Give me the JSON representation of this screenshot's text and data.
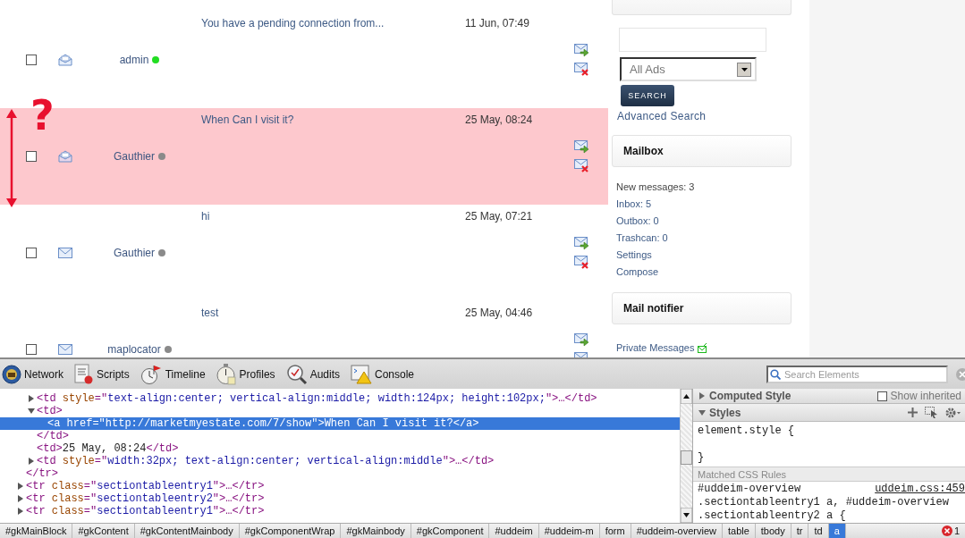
{
  "inbox": {
    "rows": [
      {
        "checked": false,
        "read": true,
        "from": "admin",
        "color": "#22dd22",
        "message": "You have a pending connection from...",
        "date": "11 Jun, 07:49",
        "highlighted": false
      },
      {
        "checked": false,
        "read": true,
        "from": "Gauthier",
        "color": "#8a8a8a",
        "message": "When Can I visit it?",
        "date": "25 May, 08:24",
        "highlighted": true
      },
      {
        "checked": false,
        "read": false,
        "from": "Gauthier",
        "color": "#8a8a8a",
        "message": "hi",
        "date": "25 May, 07:21",
        "highlighted": false
      },
      {
        "checked": false,
        "read": false,
        "from": "maplocator",
        "color": "#8a8a8a",
        "message": "test",
        "date": "25 May, 04:46",
        "highlighted": false
      }
    ]
  },
  "annotation": {
    "mark": "?"
  },
  "sidebar": {
    "select_value": "All Ads",
    "button": "SEARCH",
    "advanced_link": "Advanced Search",
    "panels": [
      {
        "title": "Mailbox",
        "items": [
          {
            "kind": "text",
            "text": "New messages: 3"
          },
          {
            "kind": "link",
            "text": "Inbox: 5"
          },
          {
            "kind": "link",
            "text": "Outbox: 0"
          },
          {
            "kind": "link",
            "text": "Trashcan: 0"
          },
          {
            "kind": "link",
            "text": "Settings"
          },
          {
            "kind": "link",
            "text": "Compose"
          }
        ]
      },
      {
        "title": "Mail notifier",
        "items": [
          {
            "kind": "notify",
            "text": "Private Messages"
          }
        ]
      }
    ]
  },
  "devtools": {
    "tabs": [
      {
        "kind": "network",
        "label": "Network",
        "selected": false
      },
      {
        "kind": "scripts",
        "label": "Scripts",
        "selected": false
      },
      {
        "kind": "timeline",
        "label": "Timeline",
        "selected": false
      },
      {
        "kind": "profiles",
        "label": "Profiles",
        "selected": false
      },
      {
        "kind": "audits",
        "label": "Audits",
        "selected": false
      },
      {
        "kind": "console",
        "label": "Console",
        "selected": false
      }
    ],
    "search": {
      "placeholder": "Search Elements"
    },
    "dom": [
      {
        "children": [
          {
            "selected": false,
            "expanded": false,
            "tokens": [
              {
                "kind": "tag",
                "text": "<td"
              },
              {
                "kind": "attr",
                "text": " style"
              },
              {
                "kind": "tag",
                "text": "=\""
              },
              {
                "kind": "value",
                "text": "text-align:center; vertical-align:middle; width:124px; height:102px;"
              },
              {
                "kind": "tag",
                "text": "\">…</td>"
              }
            ]
          },
          {
            "selected": false,
            "expanded": true,
            "tokens": [
              {
                "kind": "tag",
                "text": "<td>"
              }
            ],
            "children": [
              {
                "selected": true,
                "tokens": [
                  {
                    "text": "<a href=\"http://marketmyestate.com/7/show\">When Can I visit it?</a>"
                  }
                ]
              }
            ],
            "closing": [
              {
                "kind": "tag",
                "text": "</td>"
              }
            ]
          },
          {
            "selected": false,
            "tokens": [
              {
                "kind": "tag",
                "text": "<td>"
              },
              {
                "kind": "text",
                "text": "25 May, 08:24"
              },
              {
                "kind": "tag",
                "text": "</td>"
              }
            ]
          },
          {
            "selected": false,
            "expanded": false,
            "tokens": [
              {
                "kind": "tag",
                "text": "<td"
              },
              {
                "kind": "attr",
                "text": " style"
              },
              {
                "kind": "tag",
                "text": "=\""
              },
              {
                "kind": "value",
                "text": "width:32px; text-align:center; vertical-align:middle"
              },
              {
                "kind": "tag",
                "text": "\">…</td>"
              }
            ]
          }
        ],
        "closing": [
          {
            "kind": "tag",
            "text": "</tr>"
          }
        ]
      },
      {
        "selected": false,
        "expanded": false,
        "tokens": [
          {
            "kind": "tag",
            "text": "<tr"
          },
          {
            "kind": "attr",
            "text": " class"
          },
          {
            "kind": "tag",
            "text": "=\""
          },
          {
            "kind": "value",
            "text": "sectiontableentry1"
          },
          {
            "kind": "tag",
            "text": "\">…</tr>"
          }
        ]
      },
      {
        "selected": false,
        "expanded": false,
        "tokens": [
          {
            "kind": "tag",
            "text": "<tr"
          },
          {
            "kind": "attr",
            "text": " class"
          },
          {
            "kind": "tag",
            "text": "=\""
          },
          {
            "kind": "value",
            "text": "sectiontableentry2"
          },
          {
            "kind": "tag",
            "text": "\">…</tr>"
          }
        ]
      },
      {
        "selected": false,
        "expanded": false,
        "tokens": [
          {
            "kind": "tag",
            "text": "<tr"
          },
          {
            "kind": "attr",
            "text": " class"
          },
          {
            "kind": "tag",
            "text": "=\""
          },
          {
            "kind": "value",
            "text": "sectiontableentry1"
          },
          {
            "kind": "tag",
            "text": "\">…</tr>"
          }
        ]
      }
    ],
    "styles": {
      "computed": {
        "title": "Computed Style",
        "expanded": false
      },
      "show_inherited": {
        "label": "Show inherited",
        "checked": false
      },
      "styles_section": {
        "title": "Styles",
        "expanded": true
      },
      "element_style": [
        "element.style {",
        "}"
      ],
      "matched_header": "Matched CSS Rules",
      "rules": [
        {
          "selector": "#uddeim-overview",
          "source": "uddeim.css:459"
        },
        {
          "selector": ".sectiontableentry1 a, #uddeim-overview"
        },
        {
          "selector": ".sectiontableentry2 a {"
        }
      ]
    },
    "breadcrumbs": [
      {
        "label": "#gkMainBlock",
        "selected": false
      },
      {
        "label": "#gkContent",
        "selected": false
      },
      {
        "label": "#gkContentMainbody",
        "selected": false
      },
      {
        "label": "#gkComponentWrap",
        "selected": false
      },
      {
        "label": "#gkMainbody",
        "selected": false
      },
      {
        "label": "#gkComponent",
        "selected": false
      },
      {
        "label": "#uddeim",
        "selected": false
      },
      {
        "label": "#uddeim-m",
        "selected": false
      },
      {
        "label": "form",
        "selected": false
      },
      {
        "label": "#uddeim-overview",
        "selected": false
      },
      {
        "label": "table",
        "selected": false
      },
      {
        "label": "tbody",
        "selected": false
      },
      {
        "label": "tr",
        "selected": false
      },
      {
        "label": "td",
        "selected": false
      },
      {
        "label": "a",
        "selected": true
      }
    ],
    "error_count": "1"
  }
}
